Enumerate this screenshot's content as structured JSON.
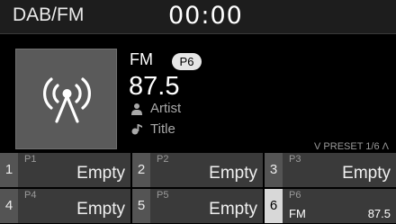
{
  "header": {
    "source_label": "DAB/FM",
    "clock": "00:00"
  },
  "now_playing": {
    "band": "FM",
    "preset_badge": "P6",
    "frequency": "87.5",
    "artist": "Artist",
    "title": "Title",
    "art_icon": "radio-broadcast-icon",
    "artist_icon": "person-icon",
    "title_icon": "music-note-icon"
  },
  "preset_page": {
    "label": "V PRESET 1/6 Λ"
  },
  "presets": [
    {
      "index": "1",
      "label": "P1",
      "value": "Empty"
    },
    {
      "index": "2",
      "label": "P2",
      "value": "Empty"
    },
    {
      "index": "3",
      "label": "P3",
      "value": "Empty"
    },
    {
      "index": "4",
      "label": "P4",
      "value": "Empty"
    },
    {
      "index": "5",
      "label": "P5",
      "value": "Empty"
    },
    {
      "index": "6",
      "label": "P6",
      "band": "FM",
      "frequency": "87.5",
      "active": true
    }
  ],
  "colors": {
    "background": "#000000",
    "header": "#1d1d1d",
    "preset_tile": "#3a3a3a",
    "preset_number": "#545454",
    "active_number": "#d8d8d8",
    "badge": "#e6e6e6",
    "muted_text": "#a9a9a9"
  }
}
